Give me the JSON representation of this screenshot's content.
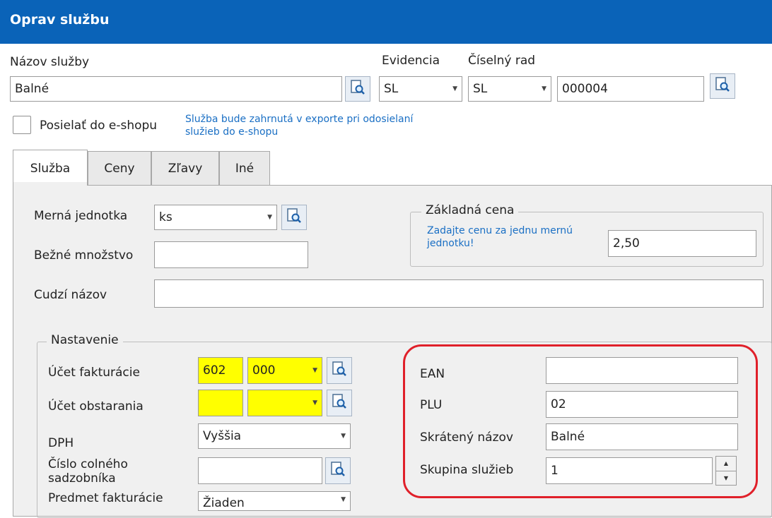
{
  "window": {
    "title": "Oprav službu"
  },
  "header": {
    "nazov_label": "Názov služby",
    "nazov_value": "Balné",
    "evidencia_label": "Evidencia",
    "evidencia_value": "SL",
    "ciselny_rad_label": "Číselný rad",
    "ciselny_rad_value": "SL",
    "cislo_value": "000004",
    "eshop_checkbox_label": "Posielať do e-shopu",
    "eshop_checked": false,
    "eshop_info": "Služba bude zahrnutá v exporte pri odosielaní služieb do e-shopu"
  },
  "tabs": [
    {
      "label": "Služba",
      "active": true
    },
    {
      "label": "Ceny",
      "active": false
    },
    {
      "label": "Zľavy",
      "active": false
    },
    {
      "label": "Iné",
      "active": false
    }
  ],
  "sluzba": {
    "merna_jednotka_label": "Merná jednotka",
    "merna_jednotka_value": "ks",
    "bezne_mnozstvo_label": "Bežné množstvo",
    "bezne_mnozstvo_value": "",
    "cudzi_nazov_label": "Cudzí názov",
    "cudzi_nazov_value": "",
    "zakladna_cena": {
      "legend": "Základná cena",
      "hint": "Zadajte cenu za jednu mernú jednotku!",
      "value": "2,50"
    },
    "nastavenie": {
      "legend": "Nastavenie",
      "ucet_fakturacie_label": "Účet fakturácie",
      "ucet_fakturacie_syn": "602",
      "ucet_fakturacie_anal": "000",
      "ucet_obstarania_label": "Účet obstarania",
      "ucet_obstarania_syn": "",
      "ucet_obstarania_anal": "",
      "dph_label": "DPH",
      "dph_value": "Vyššia",
      "colny_label_line1": "Číslo colného",
      "colny_label_line2": "sadzobníka",
      "colny_value": "",
      "predmet_label": "Predmet fakturácie",
      "predmet_value": "Žiaden",
      "ean_label": "EAN",
      "ean_value": "",
      "plu_label": "PLU",
      "plu_value": "02",
      "skrateny_nazov_label": "Skrátený názov",
      "skrateny_nazov_value": "Balné",
      "skupina_label": "Skupina služieb",
      "skupina_value": "1"
    }
  },
  "icons": {
    "lookup": "magnifier-document-icon",
    "dropdown": "chevron-down-icon",
    "spin_up": "spin-up-icon",
    "spin_down": "spin-down-icon"
  },
  "colors": {
    "titlebar": "#0a63b8",
    "info_text": "#1a6fc4",
    "highlight_field": "#ffff00",
    "annotation": "#e0202a"
  }
}
